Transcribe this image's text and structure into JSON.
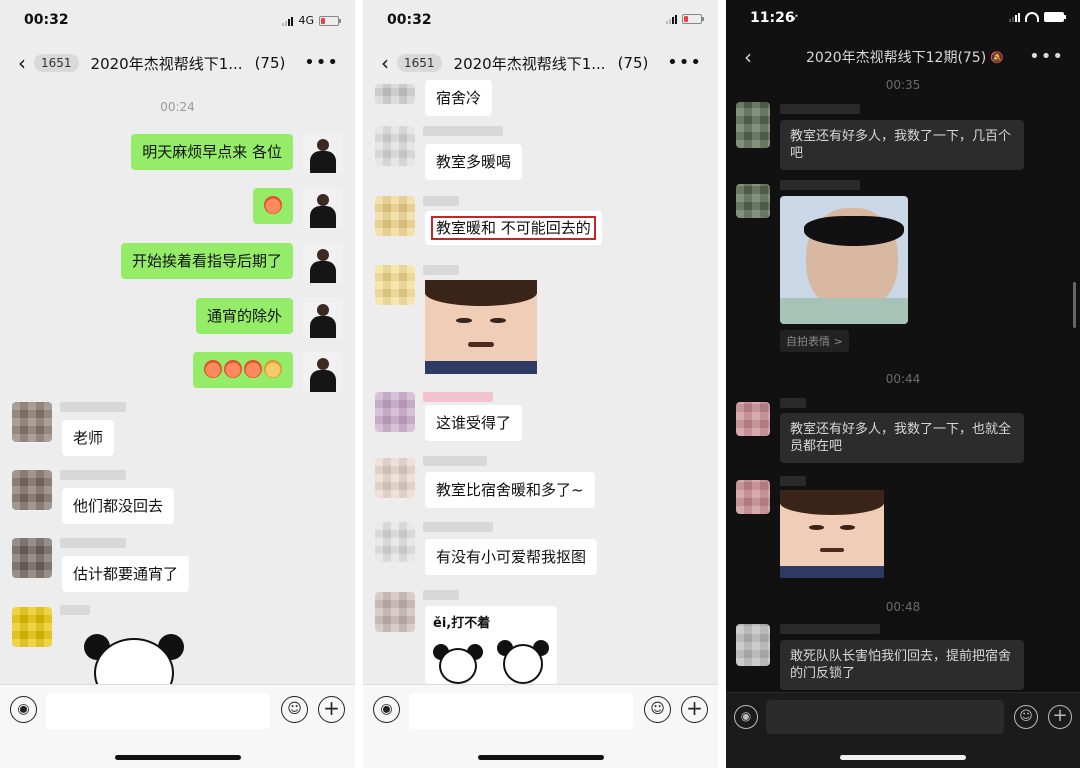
{
  "panel1": {
    "status_time": "00:32",
    "network": "4G",
    "back_count": "1651",
    "title": "2020年杰视帮线下1...",
    "member_count": "(75)",
    "timestamp": "00:24",
    "my_messages": [
      "明天麻烦早点来 各位",
      "开始挨着看指导后期了",
      "通宵的除外"
    ],
    "other_messages": [
      "老师",
      "他们都没回去",
      "估计都要通宵了"
    ]
  },
  "panel2": {
    "status_time": "00:32",
    "back_count": "1651",
    "title": "2020年杰视帮线下1...",
    "member_count": "(75)",
    "messages": [
      "宿舍冷",
      "教室多暖喝",
      "教室暖和 不可能回去的",
      "这谁受得了",
      "教室比宿舍暖和多了~",
      "有没有小可爱帮我抠图"
    ],
    "sticker_caption": "ěi,打不着"
  },
  "panel3": {
    "status_time": "11:26",
    "title": "2020年杰视帮线下12期(75)",
    "timestamps": [
      "00:35",
      "00:44",
      "00:48"
    ],
    "messages": [
      "教室还有好多人，我数了一下，几百个吧",
      "教室还有好多人，我数了一下，也就全员都在吧",
      "敢死队队长害怕我们回去，提前把宿舍的门反锁了"
    ],
    "selfie_tag": "自拍表情 >"
  }
}
